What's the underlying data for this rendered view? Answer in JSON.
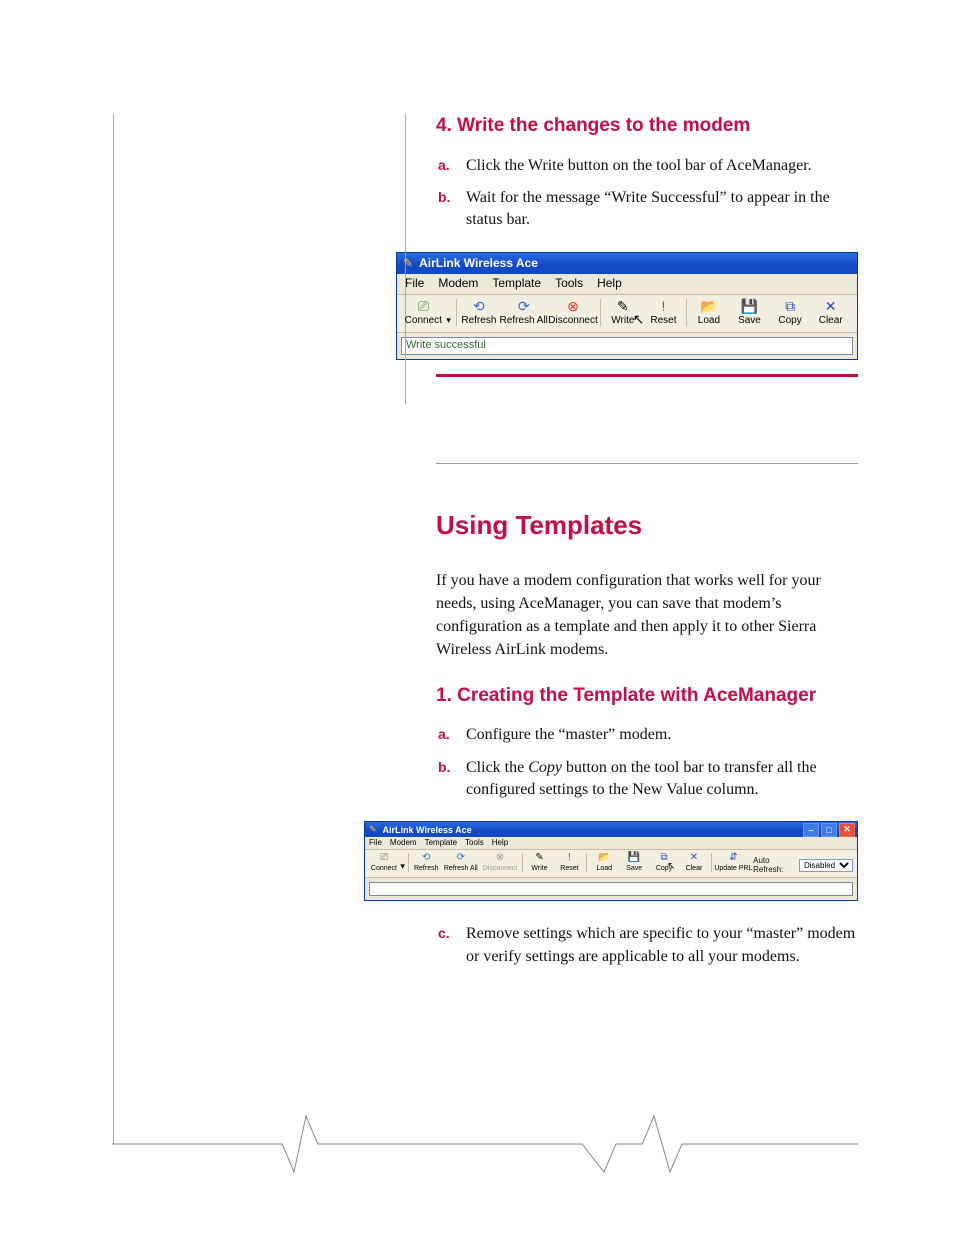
{
  "section4": {
    "heading": "4. Write the changes to the modem",
    "a": "Click the Write button on the tool bar of AceManager.",
    "b": "Wait for the message “Write Successful” to appear in the status bar."
  },
  "app1": {
    "title": "AirLink Wireless Ace",
    "menu": {
      "file": "File",
      "modem": "Modem",
      "template": "Template",
      "tools": "Tools",
      "help": "Help"
    },
    "tb": {
      "connect": "Connect",
      "refresh": "Refresh",
      "refresh_all": "Refresh All",
      "disconnect": "Disconnect",
      "write": "Write",
      "reset": "Reset",
      "load": "Load",
      "save": "Save",
      "copy": "Copy",
      "clear": "Clear"
    },
    "status": "Write successful"
  },
  "title2": "Using Templates",
  "intro": "If you have a modem configuration that works well for your needs, using AceManager, you can save that modem’s configuration as a template and then apply it to other Sierra Wireless AirLink modems.",
  "section1": {
    "heading": "1. Creating the Template with AceManager",
    "a": "Configure the “master” modem.",
    "b_prefix": "Click the ",
    "b_em": "Copy",
    "b_suffix": " button on the tool bar to transfer all the configured settings to the New Value column.",
    "c": "Remove settings which are specific to your “master” modem or verify settings are applicable to all your modems."
  },
  "app2": {
    "title": "AirLink Wireless Ace",
    "menu": {
      "file": "File",
      "modem": "Modem",
      "template": "Template",
      "tools": "Tools",
      "help": "Help"
    },
    "tb": {
      "connect": "Connect",
      "refresh": "Refresh",
      "refresh_all": "Refresh All",
      "disconnect": "Disconnect",
      "write": "Write",
      "reset": "Reset",
      "load": "Load",
      "save": "Save",
      "copy": "Copy",
      "clear": "Clear",
      "update_prl": "Update PRL"
    },
    "auto_refresh_label": "Auto Refresh:",
    "auto_refresh_value": "Disabled"
  }
}
